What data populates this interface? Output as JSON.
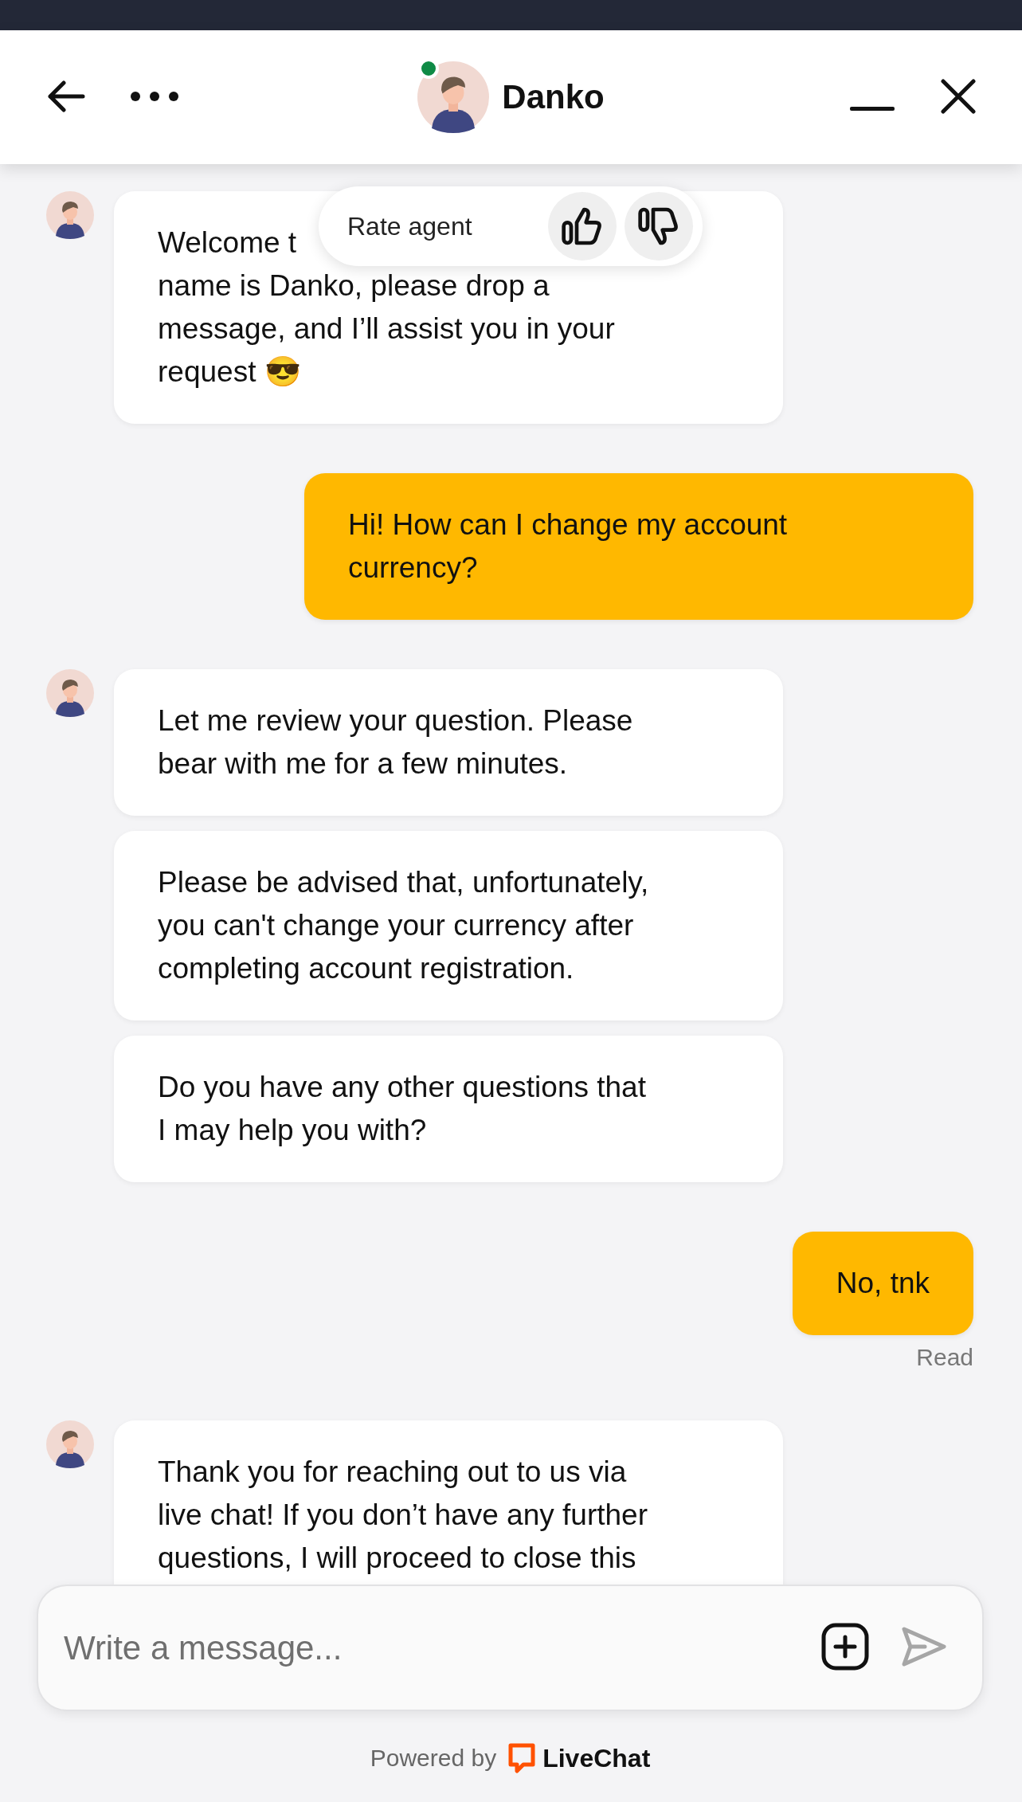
{
  "header": {
    "agent_name": "Danko",
    "online": true
  },
  "rate_popup": {
    "label": "Rate agent"
  },
  "groups": [
    {
      "kind": "agent",
      "messages": [
        "Welcome t\nname is Danko, please drop a\nmessage, and I’ll assist you in your\nrequest 😎"
      ]
    },
    {
      "kind": "user",
      "messages": [
        "Hi! How can I change my account\ncurrency?"
      ]
    },
    {
      "kind": "agent",
      "messages": [
        "Let me review your question. Please\nbear with me for a few minutes.",
        "Please be advised that, unfortunately,\nyou can't change your currency after\ncompleting account registration.",
        "Do you have any other questions that\nI may help you with?"
      ]
    },
    {
      "kind": "user",
      "messages": [
        "No, tnk"
      ],
      "status": "Read"
    },
    {
      "kind": "agent",
      "messages": [
        "Thank you for reaching out to us via\nlive chat! If you don’t have any further\nquestions, I will proceed to close this"
      ]
    }
  ],
  "composer": {
    "placeholder": "Write a message..."
  },
  "footer": {
    "prefix": "Powered by",
    "brand": "LiveChat"
  }
}
